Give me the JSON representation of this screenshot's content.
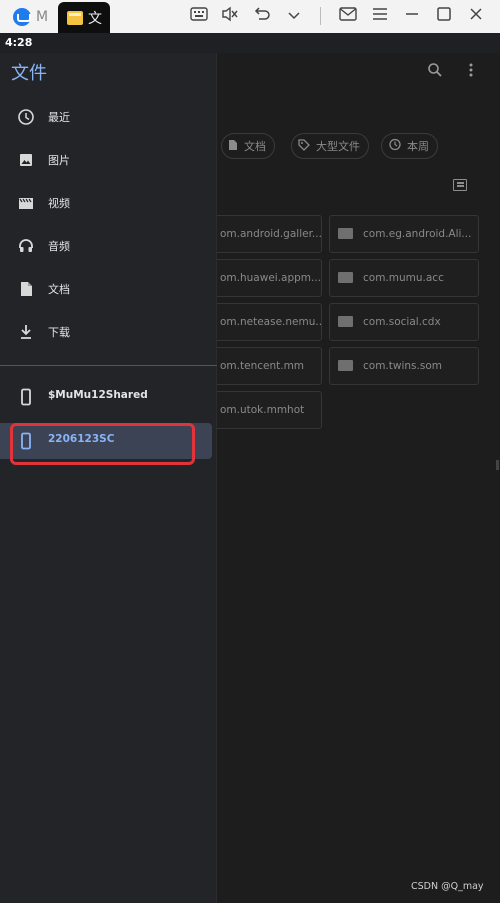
{
  "window": {
    "tabs": [
      {
        "label": "M"
      },
      {
        "label": "文"
      }
    ],
    "toolbar_icons": [
      "keyboard-icon",
      "mute-icon",
      "undo-icon",
      "chevron-down-icon",
      "mail-icon",
      "menu-icon",
      "maximize-icon",
      "close-icon"
    ]
  },
  "status_bar": {
    "time": "4:28"
  },
  "drawer": {
    "title": "文件",
    "items": [
      {
        "label": "最近",
        "icon": "clock-icon"
      },
      {
        "label": "图片",
        "icon": "image-icon"
      },
      {
        "label": "视频",
        "icon": "video-icon"
      },
      {
        "label": "音频",
        "icon": "headphones-icon"
      },
      {
        "label": "文档",
        "icon": "document-icon"
      },
      {
        "label": "下载",
        "icon": "download-icon"
      }
    ],
    "devices": [
      {
        "label": "$MuMu12Shared",
        "icon": "phone-icon",
        "selected": false
      },
      {
        "label": "2206123SC",
        "icon": "phone-icon",
        "selected": true
      }
    ]
  },
  "main": {
    "chips": [
      {
        "label": "文档",
        "icon": "document-icon"
      },
      {
        "label": "大型文件",
        "icon": "tag-icon"
      },
      {
        "label": "本周",
        "icon": "history-icon"
      }
    ],
    "folders": [
      {
        "label": "om.android.galler..."
      },
      {
        "label": "com.eg.android.Ali..."
      },
      {
        "label": "om.huawei.appm..."
      },
      {
        "label": "com.mumu.acc"
      },
      {
        "label": "om.netease.nemu..."
      },
      {
        "label": "com.social.cdx"
      },
      {
        "label": "om.tencent.mm"
      },
      {
        "label": "com.twins.som"
      },
      {
        "label": "om.utok.mmhot"
      }
    ]
  },
  "watermark": "CSDN @Q_may",
  "colors": {
    "accent": "#8ab4f8",
    "highlight": "#e2323a"
  }
}
